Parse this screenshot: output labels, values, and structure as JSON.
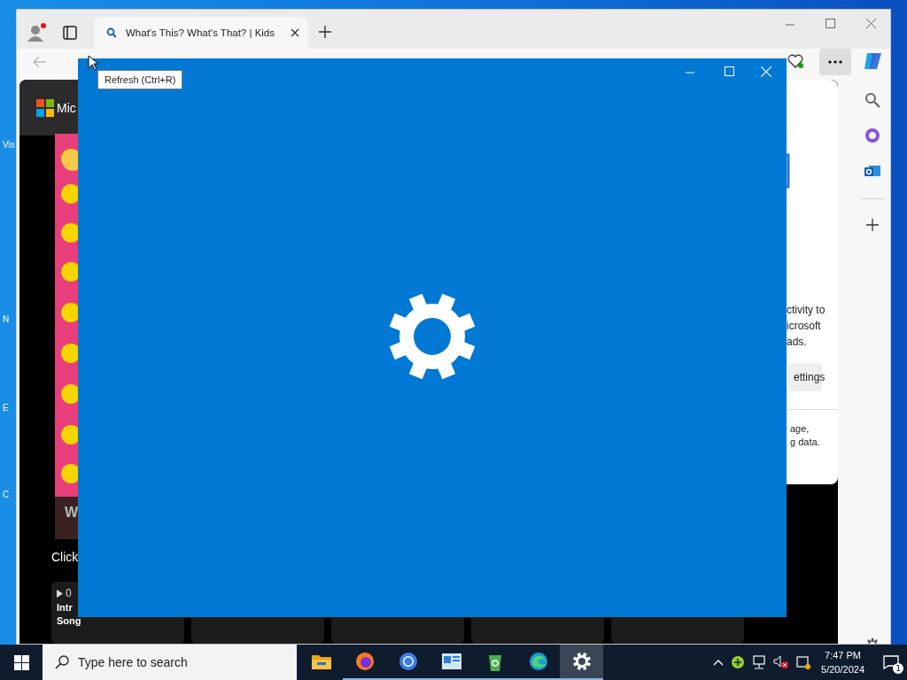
{
  "desktop_icons": [
    {
      "label": "Vis"
    },
    {
      "label": "N"
    },
    {
      "label": "E"
    },
    {
      "label": "C"
    }
  ],
  "browser": {
    "tab": {
      "title": "What's This? What's That? | Kids",
      "selected": true
    },
    "tooltip": "Refresh (Ctrl+R)",
    "page": {
      "brand": "Mic",
      "video_title": "W",
      "caption": "Click",
      "cards": [
        {
          "kind": "video",
          "duration": "0",
          "title_lines": [
            "Intr",
            "Song"
          ]
        },
        {
          "kind": "blank"
        },
        {
          "kind": "blank"
        },
        {
          "kind": "blank"
        },
        {
          "kind": "blank"
        }
      ]
    },
    "panel": {
      "lines": [
        "ctivity to",
        "icrosoft",
        "ads."
      ],
      "button": "ettings",
      "footer_lines": [
        "age,",
        "g data."
      ]
    }
  },
  "taskbar": {
    "search": {
      "placeholder": "Type here to search"
    },
    "apps": [
      {
        "kind": "explorer",
        "running": false,
        "active": false
      },
      {
        "kind": "firefox",
        "running": true,
        "active": false
      },
      {
        "kind": "chrome",
        "running": true,
        "active": false
      },
      {
        "kind": "app",
        "running": true,
        "active": false
      },
      {
        "kind": "recycle",
        "running": true,
        "active": false
      },
      {
        "kind": "edge",
        "running": true,
        "active": false
      },
      {
        "kind": "settings",
        "running": true,
        "active": true
      }
    ],
    "time": "7:47 PM",
    "date": "5/20/2024",
    "notifications": "1"
  }
}
